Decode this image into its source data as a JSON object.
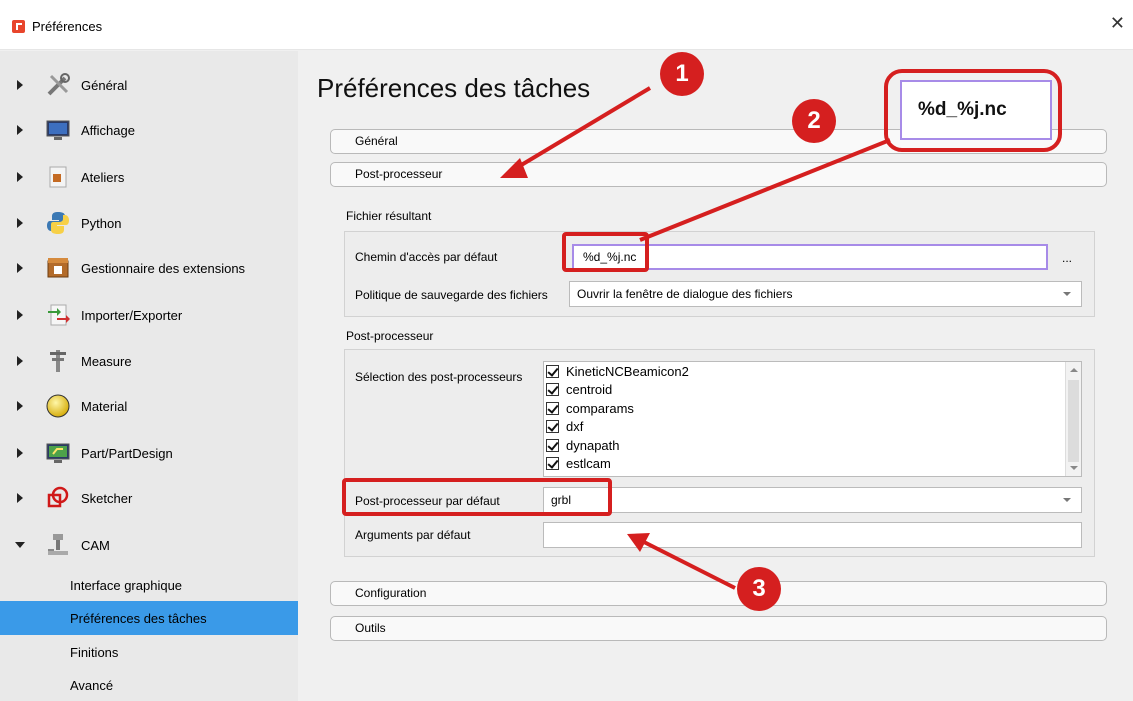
{
  "window": {
    "title": "Préférences",
    "close_glyph": "✕"
  },
  "sidebar": {
    "categories": [
      {
        "label": "Général",
        "icon": "tools-icon"
      },
      {
        "label": "Affichage",
        "icon": "monitor-icon"
      },
      {
        "label": "Ateliers",
        "icon": "workbench-icon"
      },
      {
        "label": "Python",
        "icon": "python-icon"
      },
      {
        "label": "Gestionnaire des extensions",
        "icon": "addon-manager-icon"
      },
      {
        "label": "Importer/Exporter",
        "icon": "import-export-icon"
      },
      {
        "label": "Measure",
        "icon": "caliper-icon"
      },
      {
        "label": "Material",
        "icon": "material-sphere-icon"
      },
      {
        "label": "Part/PartDesign",
        "icon": "part-design-icon"
      },
      {
        "label": "Sketcher",
        "icon": "sketcher-icon"
      },
      {
        "label": "CAM",
        "icon": "cam-mill-icon",
        "expanded": true
      }
    ],
    "cam_items": [
      {
        "label": "Interface graphique"
      },
      {
        "label": "Préférences des tâches",
        "selected": true
      },
      {
        "label": "Finitions"
      },
      {
        "label": "Avancé"
      }
    ]
  },
  "main": {
    "page_title": "Préférences des tâches",
    "sections": {
      "general": "Général",
      "post_processor": "Post-processeur",
      "configuration": "Configuration",
      "tools": "Outils"
    },
    "output_file": {
      "group_label": "Fichier résultant",
      "default_path_label": "Chemin d'accès par défaut",
      "default_path_value": "%d_%j.nc",
      "browse": "...",
      "save_policy_label": "Politique de sauvegarde des fichiers",
      "save_policy_value": "Ouvrir la fenêtre de dialogue des fichiers"
    },
    "post_processor": {
      "group_label": "Post-processeur",
      "selection_label": "Sélection des post-processeurs",
      "items": [
        {
          "label": "KineticNCBeamicon2",
          "checked": true
        },
        {
          "label": "centroid",
          "checked": true
        },
        {
          "label": "comparams",
          "checked": true
        },
        {
          "label": "dxf",
          "checked": true
        },
        {
          "label": "dynapath",
          "checked": true
        },
        {
          "label": "estlcam",
          "checked": true
        }
      ],
      "default_label": "Post-processeur par défaut",
      "default_value": "grbl",
      "args_label": "Arguments par défaut",
      "args_value": ""
    }
  },
  "annotations": {
    "zoom_text": "%d_%j.nc",
    "badges": [
      "1",
      "2",
      "3"
    ],
    "color": "#d51f1f"
  },
  "colors": {
    "selection": "#3a9ae8",
    "focus_border": "#a78be8"
  }
}
